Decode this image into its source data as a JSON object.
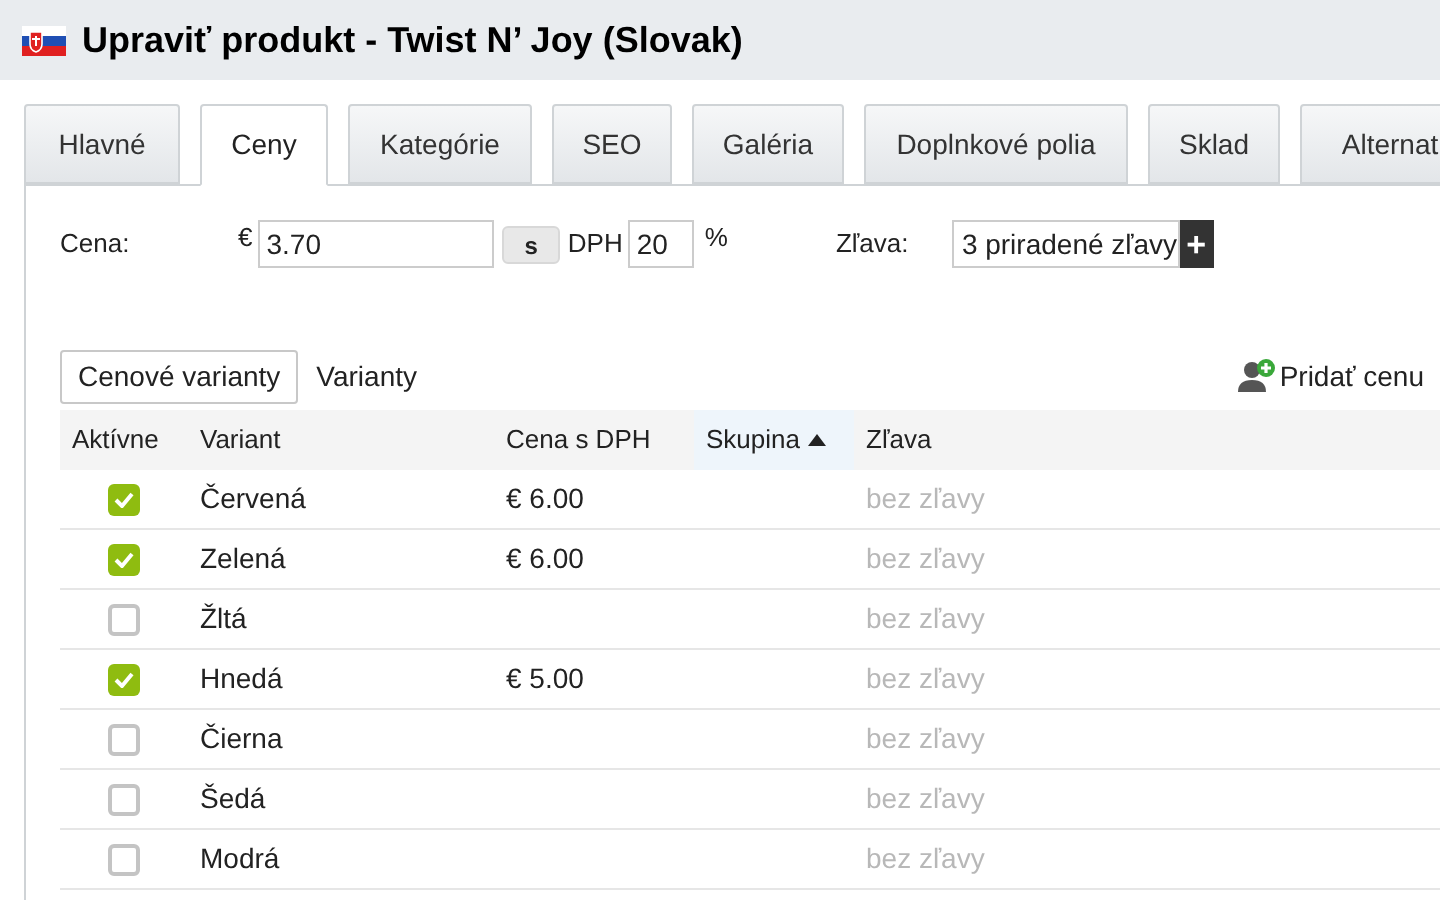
{
  "window": {
    "title": "Upraviť produkt - Twist N’ Joy (Slovak)"
  },
  "tabs": [
    {
      "label": "Hlavné",
      "selected": false
    },
    {
      "label": "Ceny",
      "selected": true
    },
    {
      "label": "Kategórie",
      "selected": false
    },
    {
      "label": "SEO",
      "selected": false
    },
    {
      "label": "Galéria",
      "selected": false
    },
    {
      "label": "Doplnkové polia",
      "selected": false
    },
    {
      "label": "Sklad",
      "selected": false
    },
    {
      "label": "Alternat",
      "selected": false
    }
  ],
  "price": {
    "label": "Cena:",
    "currency": "€",
    "value": "3.70",
    "toggle": "s",
    "vat_label": "DPH",
    "vat_value": "20",
    "percent": "%"
  },
  "discount": {
    "label": "Zľava:",
    "value": "3 priradené zľavy",
    "add": "+"
  },
  "subtabs": [
    {
      "label": "Cenové varianty",
      "selected": true
    },
    {
      "label": "Varianty",
      "selected": false
    }
  ],
  "add_price": "Pridať cenu",
  "table": {
    "columns": [
      {
        "label": "Aktívne",
        "sorted": false
      },
      {
        "label": "Variant",
        "sorted": false
      },
      {
        "label": "Cena s DPH",
        "sorted": false
      },
      {
        "label": "Skupina",
        "sorted": true
      },
      {
        "label": "Zľava",
        "sorted": false
      }
    ],
    "rows": [
      {
        "checked": true,
        "variant": "Červená",
        "price": "€ 6.00",
        "discount": "bez zľavy"
      },
      {
        "checked": true,
        "variant": "Zelená",
        "price": "€ 6.00",
        "discount": "bez zľavy"
      },
      {
        "checked": false,
        "variant": "Žltá",
        "price": "",
        "discount": "bez zľavy"
      },
      {
        "checked": true,
        "variant": "Hnedá",
        "price": "€ 5.00",
        "discount": "bez zľavy"
      },
      {
        "checked": false,
        "variant": "Čierna",
        "price": "",
        "discount": "bez zľavy"
      },
      {
        "checked": false,
        "variant": "Šedá",
        "price": "",
        "discount": "bez zľavy"
      },
      {
        "checked": false,
        "variant": "Modrá",
        "price": "",
        "discount": "bez zľavy"
      }
    ]
  }
}
